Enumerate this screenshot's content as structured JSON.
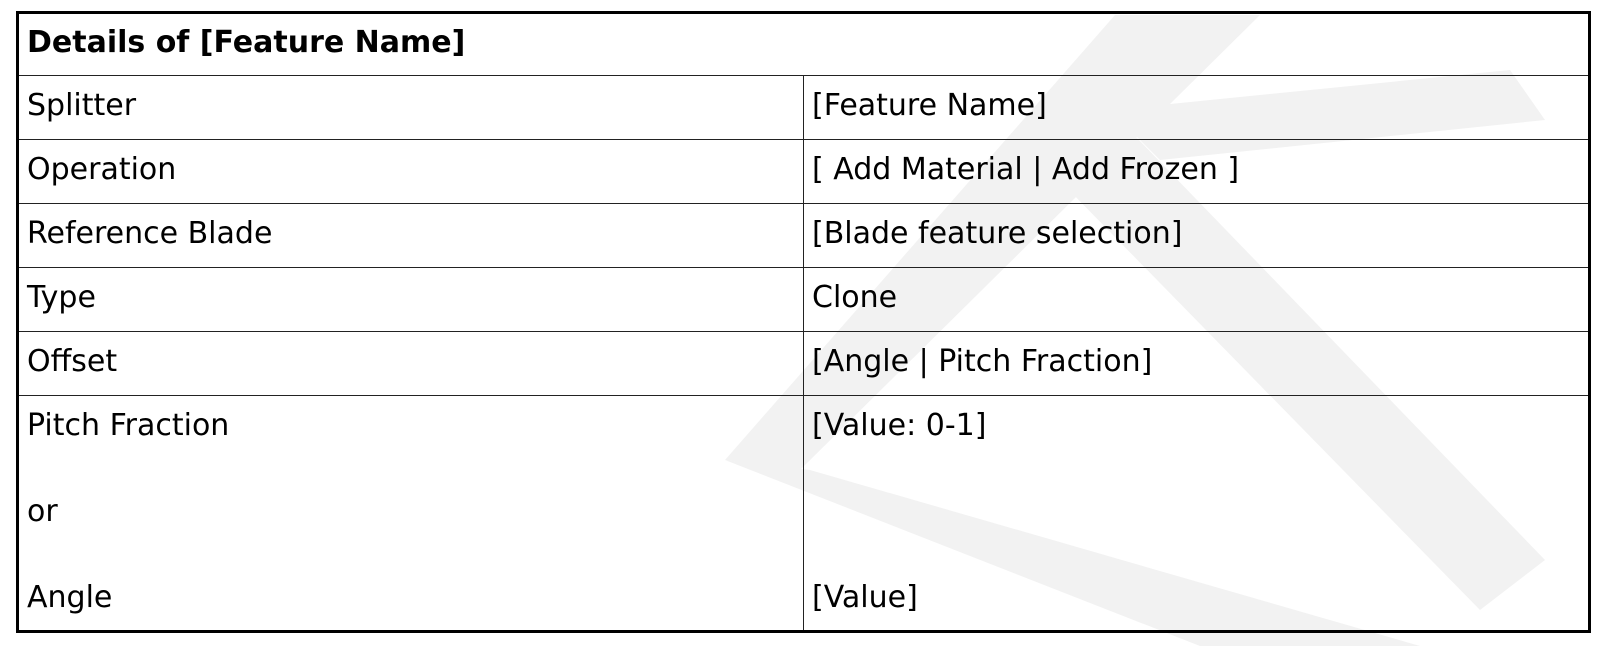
{
  "table": {
    "title": "Details of [Feature Name]",
    "rows": [
      {
        "label": "Splitter",
        "value": "[Feature Name]"
      },
      {
        "label": "Operation",
        "value": "[ Add Material | Add Frozen ]"
      },
      {
        "label": "Reference Blade",
        "value": "[Blade feature selection]"
      },
      {
        "label": "Type",
        "value": "Clone"
      },
      {
        "label": "Offset",
        "value": "[Angle | Pitch Fraction]"
      }
    ],
    "last_row": {
      "labels": [
        "Pitch Fraction",
        "or",
        "Angle"
      ],
      "values": [
        "[Value: 0-1]",
        "",
        "[Value]"
      ]
    }
  },
  "watermark": {
    "color": "#f2f2f2",
    "icon": "logo-watermark"
  }
}
